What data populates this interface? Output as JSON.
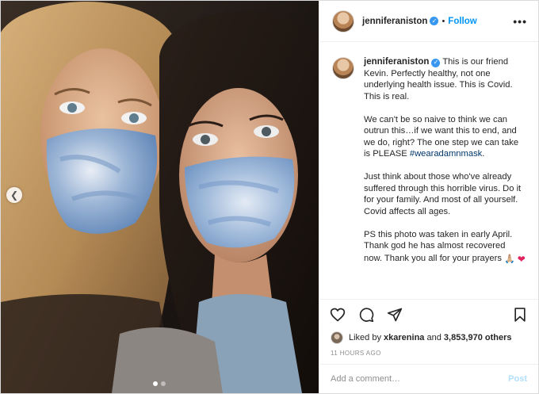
{
  "post": {
    "username": "jenniferaniston",
    "separator": "•",
    "follow_label": "Follow",
    "more_label": "•••",
    "caption_lead": "This is our friend Kevin. Perfectly healthy, not one underlying health issue. This is Covid. This is real.",
    "caption_p2_text": "We can't be so naive to think we can outrun this…if we want this to end, and we do, right? The one step we can take is PLEASE",
    "hashtag": "#wearadamnmask",
    "hashtag_suffix": ".",
    "caption_p3": "Just think about those who've already suffered through this horrible virus. Do it for your family. And most of all yourself. Covid affects all ages.",
    "caption_p4": "PS this photo was taken in early April. Thank god he has almost recovered now. Thank you all for your prayers",
    "emoji_pray": "🙏🏼",
    "emoji_heart": "❤"
  },
  "likes": {
    "prefix": "Liked by",
    "user": "xkarenina",
    "and": "and",
    "count": "3,853,970 others"
  },
  "timestamp": "11 HOURS AGO",
  "comment": {
    "placeholder": "Add a comment…",
    "post_label": "Post"
  },
  "carousel": {
    "prev_icon": "chevron-left-icon",
    "total_slides": 2,
    "active_slide": 1
  },
  "colors": {
    "link_blue": "#0095f6",
    "hashtag": "#00376b",
    "post_disabled": "#b2dffc",
    "verified_blue": "#3897f0"
  }
}
